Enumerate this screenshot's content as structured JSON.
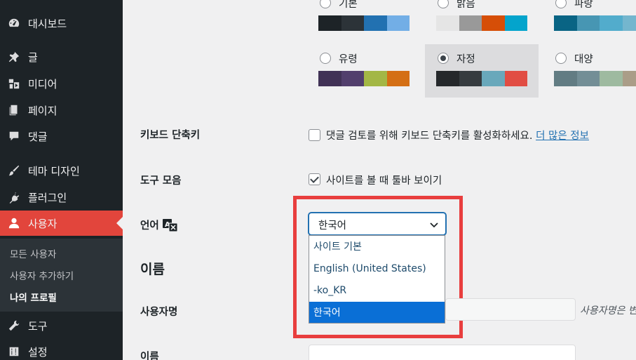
{
  "sidebar": {
    "items": [
      {
        "label": "대시보드",
        "icon": "dashboard-icon"
      },
      {
        "label": "글",
        "icon": "pin-icon"
      },
      {
        "label": "미디어",
        "icon": "media-icon"
      },
      {
        "label": "페이지",
        "icon": "pages-icon"
      },
      {
        "label": "댓글",
        "icon": "comments-icon"
      },
      {
        "label": "테마 디자인",
        "icon": "brush-icon"
      },
      {
        "label": "플러그인",
        "icon": "plugin-icon"
      },
      {
        "label": "사용자",
        "icon": "user-icon"
      },
      {
        "label": "도구",
        "icon": "wrench-icon"
      },
      {
        "label": "설정",
        "icon": "settings-icon"
      }
    ],
    "submenu": [
      "모든 사용자",
      "사용자 추가하기",
      "나의 프로필"
    ]
  },
  "colors": {
    "sidebar_bg": "#1d2327",
    "active": "#e2453c",
    "link": "#2271b1",
    "highlight": "#e83e3e"
  },
  "schemes": [
    {
      "name": "기본",
      "swatches": [
        "#1d2327",
        "#2c3338",
        "#2271b1",
        "#72aee6"
      ]
    },
    {
      "name": "밝음",
      "swatches": [
        "#e5e5e5",
        "#999999",
        "#d64e07",
        "#04a4cc"
      ]
    },
    {
      "name": "파랑",
      "swatches": [
        "#096484",
        "#4796b3",
        "#52accc",
        "#74b6ce"
      ]
    },
    {
      "name": "유령",
      "swatches": [
        "#413256",
        "#523f6d",
        "#a3b745",
        "#d46f15"
      ]
    },
    {
      "name": "자정",
      "swatches": [
        "#25282b",
        "#363b3f",
        "#69a8bb",
        "#e14d43"
      ],
      "selected": true
    },
    {
      "name": "대양",
      "swatches": [
        "#627c83",
        "#738e96",
        "#9ebaa0",
        "#aa9d88"
      ]
    }
  ],
  "keyboard": {
    "label": "키보드 단축키",
    "text": "댓글 검토를 위해 키보드 단축키를 활성화하세요.",
    "link": "더 많은 정보",
    "checked": false
  },
  "toolbar": {
    "label": "도구 모음",
    "text": "사이트를 볼 때 툴바 보이기",
    "checked": true
  },
  "language": {
    "label": "언어",
    "icon": "translation-icon",
    "selected": "한국어",
    "options": [
      "사이트 기본",
      "English (United States)",
      "-ko_KR",
      "한국어"
    ]
  },
  "name_section": {
    "title": "이름",
    "username_label": "사용자명",
    "username_hint": "사용자명은 변",
    "firstname_label": "이름"
  }
}
